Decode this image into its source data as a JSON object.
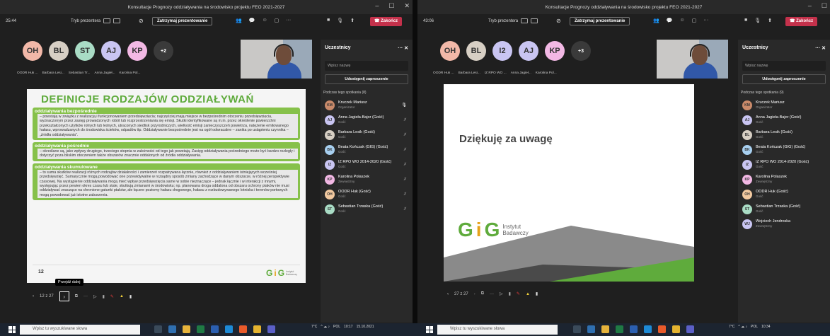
{
  "left": {
    "title": "Konsultacje Prognozy oddziaływania na środowisko projektu FEO 2021-2027",
    "timer": "25:44",
    "mode_label": "Tryb prezentera",
    "stop_label": "Zatrzymaj prezentowanie",
    "end_label": "Zakończ",
    "avatars": [
      {
        "initials": "OH",
        "label": "OODR Huk ...",
        "color": "#f2b8a8"
      },
      {
        "initials": "BL",
        "label": "Barbara Lesi...",
        "color": "#d7cfc4"
      },
      {
        "initials": "ST",
        "label": "Sebastian Tr...",
        "color": "#a9dcc5"
      },
      {
        "initials": "AJ",
        "label": "Anna Jagieł...",
        "color": "#c9c5f2"
      },
      {
        "initials": "KP",
        "label": "Karolina Pol...",
        "color": "#f2b8e4"
      }
    ],
    "more": "+2",
    "panel": {
      "title": "Uczestnicy",
      "search_placeholder": "Wpisz nazwę",
      "invite": "Udostępnij zaproszenie",
      "section": "Podczas tego spotkania (8)",
      "people": [
        {
          "initials": "KM",
          "name": "Kruczek Mariusz",
          "role": "Organizator",
          "color": "#c98a6a"
        },
        {
          "initials": "AJ",
          "name": "Anna Jagieła-Bajor (Gość)",
          "role": "Gość",
          "color": "#c9c5f2"
        },
        {
          "initials": "BL",
          "name": "Barbara Lesik (Gość)",
          "role": "Gość",
          "color": "#d7cfc4"
        },
        {
          "initials": "BK",
          "name": "Beata Kończak (GIG) (Gość)",
          "role": "Gość",
          "color": "#a8d0f0"
        },
        {
          "initials": "IZ",
          "name": "IZ RPO WO 2014-2020 (Gość)",
          "role": "Gość",
          "color": "#c9c5f2"
        },
        {
          "initials": "KP",
          "name": "Karolina Polaszek",
          "role": "Zewnętrzny",
          "color": "#f2b8e4"
        },
        {
          "initials": "OH",
          "name": "OODR Huk (Gość)",
          "role": "Gość",
          "color": "#f2c9a0"
        },
        {
          "initials": "ST",
          "name": "Sebastian Trzaska (Gość)",
          "role": "Gość",
          "color": "#a9dcc5"
        }
      ]
    },
    "slide": {
      "title": "DEFINICJE RODZAJÓW ODDZIAŁYWAŃ",
      "sections": [
        {
          "heading": "oddziaływania bezpośrednie",
          "text": "– powstają w związku z realizacją i funkcjonowaniem przedsięwzięcia; najczęściej mają miejsce w bezpośrednim otoczeniu przedsięwzięcia, wyznaczonym przez zasięg prowadzonych robót lub rozprzestrzeniania się emisji. Skutki identyfikowane są m.in. przez określenie powierzchni przekształconych użytków rolnych lub leśnych, utraconych siedlisk przyrodniczych, wielkość emisji zanieczyszczeń powietrza, natężenie emitowanego hałasu, wprowadzanych do środowiska ścieków, odpadów itp. Oddziaływanie bezpośrednie jest na ogół odwracalne – zanika po ustąpieniu czynnika – „źródła oddziaływania”."
        },
        {
          "heading": "oddziaływania pośrednie",
          "text": "– określane są, jako wpływy drugiego, trzeciego stopnia w zależności od tego jak powstają. Zasięg oddziaływania pośredniego może być bardzo rozległy i dotyczyć poza bliskim otoczeniem także obszarów znacznie oddalonych od źródła oddziaływania."
        },
        {
          "heading": "oddziaływania skumulowane",
          "text": "– to suma skutków realizacji różnych rodzajów działalności i zamierzeń rozpatrywana łącznie, również z oddziaływaniem istniejących wcześniej przedsięwzięć. Sumarycznie mogą powodować one przewidywalne w rozsądny sposób zmiany zachodzące w danym obszarze, w różnej perspektywie czasowej. Na wystąpienie oddziaływania mogą mieć wpływ przedsięwzięcia same w sobie nieznaczące – jednak łącznie i w interakcji z innymi, występując przez pewien okres czasu lub stale, skutkują zmianami w środowisku; np. planowana droga oddalona od obszaru ochrony ptaków nie musi oddziaływać znacząco na chronione gatunki ptaków, ale łączne poziomy hałasu drogowego, hałasu z rozbudowywanego lotniska i terenów portowych mogą powodować już istotne zaburzenia."
        }
      ],
      "page": "12",
      "logo_top": "Instytut",
      "logo_bottom": "Badawczy"
    },
    "nav": {
      "counter": "12 z 27",
      "tooltip": "Przejdź dalej"
    }
  },
  "right": {
    "title": "Konsultacje Prognozy oddziaływania na środowisko projektu FEO 2021-2027",
    "timer": "43:06",
    "mode_label": "Tryb prezentera",
    "stop_label": "Zatrzymaj prezentowanie",
    "end_label": "Zakończ",
    "avatars": [
      {
        "initials": "OH",
        "label": "OODR Huk ...",
        "color": "#f2b8a8"
      },
      {
        "initials": "BL",
        "label": "Barbara Lesi...",
        "color": "#d7cfc4"
      },
      {
        "initials": "I2",
        "label": "IZ RPO WO ...",
        "color": "#c9c5f2"
      },
      {
        "initials": "AJ",
        "label": "Anna Jagieł...",
        "color": "#c9c5f2"
      },
      {
        "initials": "KP",
        "label": "Karolina Pol...",
        "color": "#f2b8e4"
      }
    ],
    "more": "+3",
    "panel": {
      "title": "Uczestnicy",
      "search_placeholder": "Wpisz nazwę",
      "invite": "Udostępnij zaproszenie",
      "section": "Podczas tego spotkania (9)",
      "people": [
        {
          "initials": "KM",
          "name": "Kruczek Mariusz",
          "role": "Organizator",
          "color": "#c98a6a"
        },
        {
          "initials": "AJ",
          "name": "Anna Jagieła-Bajor (Gość)",
          "role": "Gość",
          "color": "#c9c5f2"
        },
        {
          "initials": "BL",
          "name": "Barbara Lesik (Gość)",
          "role": "Gość",
          "color": "#d7cfc4"
        },
        {
          "initials": "BK",
          "name": "Beata Kończak (GIG) (Gość)",
          "role": "Gość",
          "color": "#a8d0f0"
        },
        {
          "initials": "IZ",
          "name": "IZ RPO WO 2014-2020 (Gość)",
          "role": "Gość",
          "color": "#c9c5f2"
        },
        {
          "initials": "KP",
          "name": "Karolina Polaszek",
          "role": "Zewnętrzny",
          "color": "#f2b8e4"
        },
        {
          "initials": "OH",
          "name": "OODR Huk (Gość)",
          "role": "Gość",
          "color": "#f2c9a0"
        },
        {
          "initials": "ST",
          "name": "Sebastian Trzaska (Gość)",
          "role": "Gość",
          "color": "#a9dcc5"
        },
        {
          "initials": "WJ",
          "name": "Wojciech Jendroska",
          "role": "Zewnętrzny",
          "color": "#c9c5f2"
        }
      ]
    },
    "slide": {
      "heading": "Dziękuję za uwagę",
      "logo_top": "Instytut",
      "logo_bottom": "Badawczy"
    },
    "nav": {
      "counter": "27 z 27"
    }
  },
  "taskbar": {
    "search_placeholder": "Wpisz tu wyszukiwane słowa",
    "left_tray": {
      "temp": "7°C",
      "lang": "POL",
      "lang2": "PLP",
      "time": "10:17",
      "date": "15.10.2021"
    },
    "right_tray": {
      "temp": "7°C",
      "lang": "POL",
      "time": "10:34"
    }
  }
}
